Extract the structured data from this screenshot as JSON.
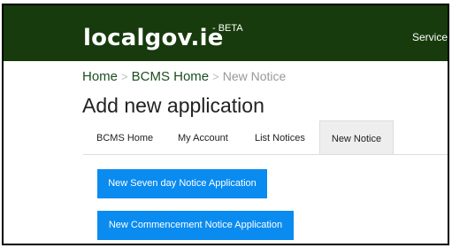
{
  "header": {
    "logo": "localgov.ie",
    "badge": "- BETA",
    "services_link": "Service"
  },
  "breadcrumb": {
    "items": [
      "Home",
      "BCMS Home"
    ],
    "separator": ">",
    "current": "New Notice"
  },
  "page": {
    "title": "Add new application"
  },
  "tabs": [
    {
      "label": "BCMS Home"
    },
    {
      "label": "My Account"
    },
    {
      "label": "List Notices"
    },
    {
      "label": "New Notice",
      "active": true
    }
  ],
  "actions": {
    "seven_day": "New Seven day Notice Application",
    "commencement": "New Commencement Notice Application"
  },
  "colors": {
    "header_bg": "#173b0c",
    "button_bg": "#0a8bf0",
    "link": "#1a4f1d"
  }
}
